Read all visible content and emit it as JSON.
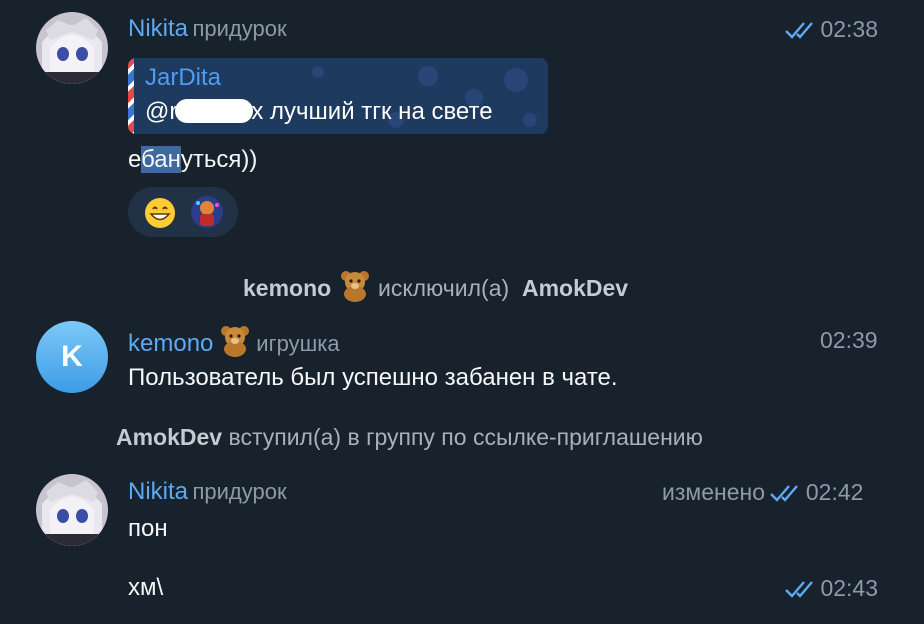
{
  "messages": [
    {
      "author": "Nikita",
      "role": "придурок",
      "time": "02:38",
      "quote": {
        "title": "JarDita",
        "text_before": "@r",
        "text_after": "x лучший тгк на свете"
      },
      "text_highlight_pre": "е",
      "text_highlight": "бан",
      "text_highlight_post": "уться))",
      "reactions": [
        "grinning-emoji",
        "avatar-reaction"
      ]
    },
    {
      "author": "kemono",
      "role": "игрушка",
      "time": "02:39",
      "avatar_letter": "K",
      "text": "Пользователь был успешно забанен в чате."
    },
    {
      "author": "Nikita",
      "role": "придурок",
      "edited_label": "изменено",
      "time": "02:42",
      "text": "пон",
      "followup_text": "хм\\",
      "followup_time": "02:43"
    }
  ],
  "service": [
    {
      "actor": "kemono",
      "action": "исключил(а)",
      "target": "AmokDev"
    },
    {
      "actor": "AmokDev",
      "action": "вступил(а) в группу по ссылке-приглашению"
    }
  ],
  "colors": {
    "background": "#18222d",
    "name": "#5eaaf1",
    "accent": "#4e9df5",
    "ticks": "#5eaaf1"
  }
}
